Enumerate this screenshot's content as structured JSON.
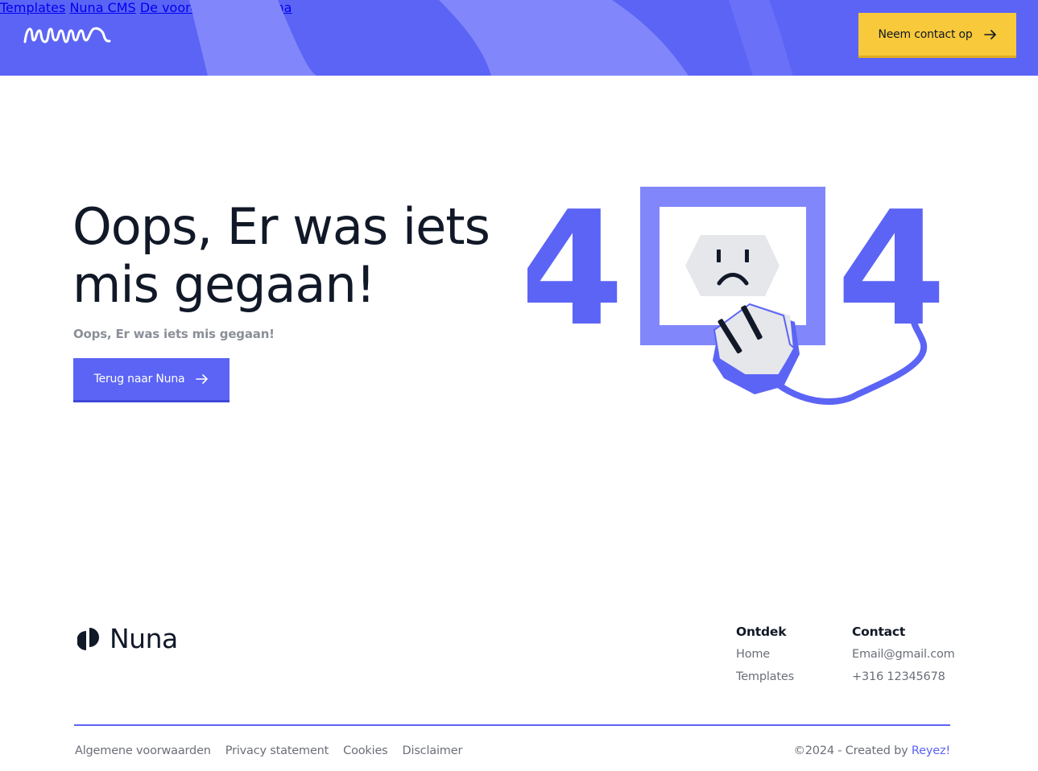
{
  "header": {
    "logo_text": "nuna",
    "nav": [
      {
        "label": "Templates"
      },
      {
        "label": "Nuna CMS"
      },
      {
        "label": "De voordelen van Nuna"
      }
    ],
    "cta_label": "Neem contact op",
    "cta_icon": "arrow-right-icon",
    "colors": {
      "primary": "#5c64f5",
      "accent": "#f8c93a"
    }
  },
  "hero": {
    "title": "Oops, Er was iets mis gegaan!",
    "subtitle": "Oops, Er was iets mis gegaan!",
    "button_label": "Terug naar Nuna",
    "button_icon": "arrow-right-icon",
    "illustration": {
      "digit_left": "4",
      "digit_right": "4",
      "icon": "unplugged-socket-icon"
    }
  },
  "footer": {
    "brand": "Nuna",
    "columns": [
      {
        "title": "Ontdek",
        "links": [
          "Home",
          "Templates"
        ]
      },
      {
        "title": "Contact",
        "links": [
          "Email@gmail.com",
          "+316 12345678"
        ]
      }
    ],
    "legal_links": [
      "Algemene voorwaarden",
      "Privacy statement",
      "Cookies",
      "Disclaimer"
    ],
    "copyright_prefix": "©2024 - Created by ",
    "copyright_link": "Reyez!"
  }
}
